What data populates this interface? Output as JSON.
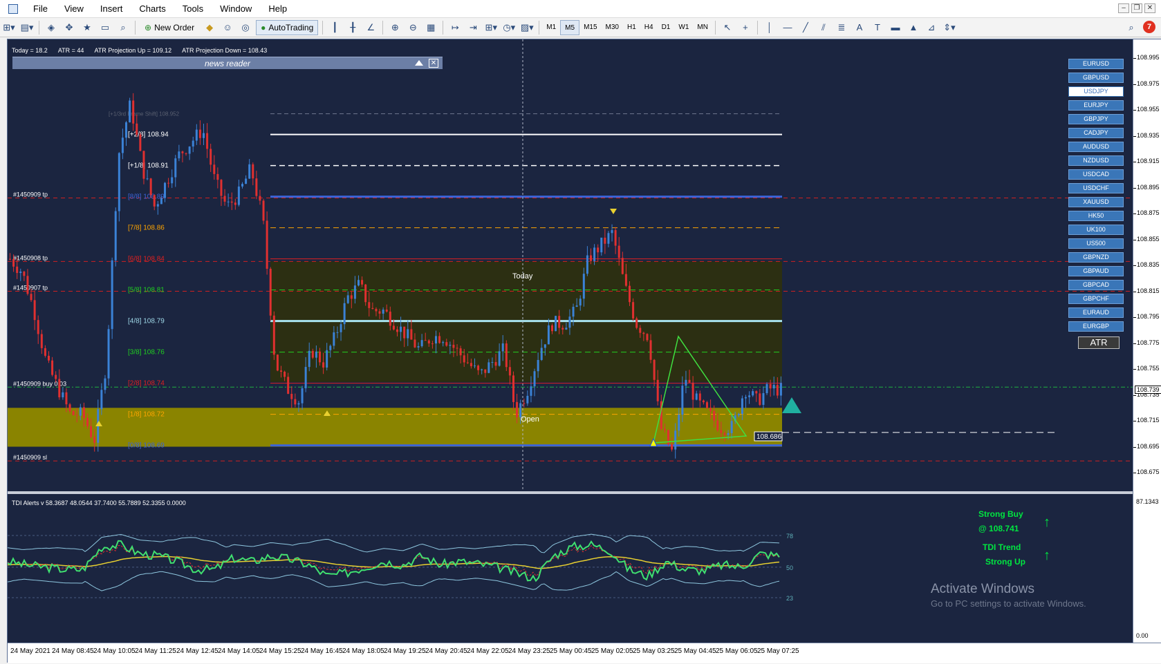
{
  "menu": [
    "File",
    "View",
    "Insert",
    "Charts",
    "Tools",
    "Window",
    "Help"
  ],
  "toolbar": {
    "new_order": "New Order",
    "autotrading": "AutoTrading",
    "timeframes": [
      "M1",
      "M5",
      "M15",
      "M30",
      "H1",
      "H4",
      "D1",
      "W1",
      "MN"
    ],
    "active_timeframe": "M5",
    "notification_count": "7"
  },
  "info_line": {
    "today": "Today = 18.2",
    "atr": "ATR = 44",
    "atr_up": "ATR Projection Up = 109.12",
    "atr_down": "ATR Projection Down = 108.43"
  },
  "news_reader": {
    "title": "news reader"
  },
  "symbols": [
    "EURUSD",
    "GBPUSD",
    "USDJPY",
    "EURJPY",
    "GBPJPY",
    "CADJPY",
    "AUDUSD",
    "NZDUSD",
    "USDCAD",
    "USDCHF",
    "XAUUSD",
    "HK50",
    "UK100",
    "US500",
    "GBPNZD",
    "GBPAUD",
    "GBPCAD",
    "GBPCHF",
    "EURAUD",
    "EURGBP"
  ],
  "selected_symbol": "USDJPY",
  "atr_button": "ATR",
  "murrey_levels": [
    {
      "label": "[+1/3rd Frame Shift]",
      "value": "108.952",
      "color": "#5a6070"
    },
    {
      "label": "[+2/8]",
      "value": "108.94",
      "color": "#ffffff"
    },
    {
      "label": "[+1/8]",
      "value": "108.91",
      "color": "#ffffff"
    },
    {
      "label": "[8/8]",
      "value": "108.89",
      "color": "#3c64d8"
    },
    {
      "label": "[7/8]",
      "value": "108.86",
      "color": "#ffa500"
    },
    {
      "label": "[6/8]",
      "value": "108.84",
      "color": "#e02020"
    },
    {
      "label": "[5/8]",
      "value": "108.81",
      "color": "#20d020"
    },
    {
      "label": "[4/8]",
      "value": "108.79",
      "color": "#9fd8e8"
    },
    {
      "label": "[3/8]",
      "value": "108.76",
      "color": "#20d020"
    },
    {
      "label": "[2/8]",
      "value": "108.74",
      "color": "#e02020"
    },
    {
      "label": "[1/8]",
      "value": "108.72",
      "color": "#ffa500"
    },
    {
      "label": "[0/8]",
      "value": "108.69",
      "color": "#3c64d8"
    }
  ],
  "order_labels": [
    {
      "text": "#1450909 tp",
      "price": 108.887
    },
    {
      "text": "#1450908 tp",
      "price": 108.838
    },
    {
      "text": "#1450907 tp",
      "price": 108.815
    },
    {
      "text": "#1450909 buy 0.03",
      "price": 108.741
    },
    {
      "text": "#1450909 sl",
      "price": 108.684
    }
  ],
  "chart_labels": {
    "today": "Today",
    "open": "Open",
    "current_price_tag": "108.739",
    "low_price_tag": "108.686"
  },
  "tdi": {
    "header": "TDI Alerts v 58.3687 48.0544 37.7400 55.7889 52.3355 0.0000",
    "levels": [
      "78",
      "50",
      "23"
    ],
    "signal_1": "Strong Buy",
    "signal_2": "@ 108.741",
    "signal_3": "TDI Trend",
    "signal_4": "Strong Up",
    "axis_top": "87.1343",
    "axis_bottom": "0.00"
  },
  "price_axis": [
    "108.995",
    "108.975",
    "108.955",
    "108.935",
    "108.915",
    "108.895",
    "108.875",
    "108.855",
    "108.835",
    "108.815",
    "108.795",
    "108.775",
    "108.755",
    "108.735",
    "108.715",
    "108.695",
    "108.675"
  ],
  "time_axis": [
    "24 May 2021",
    "24 May 08:45",
    "24 May 10:05",
    "24 May 11:25",
    "24 May 12:45",
    "24 May 14:05",
    "24 May 15:25",
    "24 May 16:45",
    "24 May 18:05",
    "24 May 19:25",
    "24 May 20:45",
    "24 May 22:05",
    "24 May 23:25",
    "25 May 00:45",
    "25 May 02:05",
    "25 May 03:25",
    "25 May 04:45",
    "25 May 06:05",
    "25 May 07:25"
  ],
  "watermark": {
    "line1": "Activate Windows",
    "line2": "Go to PC settings to activate Windows."
  },
  "chart_data": {
    "type": "candlestick",
    "symbol": "USDJPY",
    "timeframe": "M5",
    "price_range": [
      108.665,
      109.005
    ],
    "close_points": [
      108.84,
      108.83,
      108.8,
      108.76,
      108.74,
      108.72,
      108.72,
      108.7,
      108.76,
      108.92,
      108.96,
      108.91,
      108.88,
      108.9,
      108.92,
      108.93,
      108.94,
      108.9,
      108.88,
      108.89,
      108.91,
      108.87,
      108.76,
      108.74,
      108.73,
      108.77,
      108.76,
      108.78,
      108.81,
      108.82,
      108.8,
      108.8,
      108.79,
      108.78,
      108.77,
      108.78,
      108.78,
      108.77,
      108.76,
      108.75,
      108.76,
      108.77,
      108.72,
      108.74,
      108.77,
      108.79,
      108.79,
      108.8,
      108.84,
      108.85,
      108.86,
      108.82,
      108.79,
      108.78,
      108.71,
      108.69,
      108.75,
      108.73,
      108.72,
      108.71,
      108.71,
      108.74,
      108.73,
      108.74,
      108.739
    ],
    "tdi_rsi": [
      55,
      52,
      50,
      48,
      48,
      68,
      70,
      62,
      60,
      55,
      48,
      48,
      58,
      55,
      60,
      57,
      52,
      42,
      45,
      50,
      55,
      52,
      60,
      52,
      55,
      53,
      50,
      45,
      40,
      60,
      68,
      70,
      65,
      48,
      42,
      55,
      48,
      47,
      52,
      50,
      62,
      60
    ],
    "current_price": 108.739
  }
}
